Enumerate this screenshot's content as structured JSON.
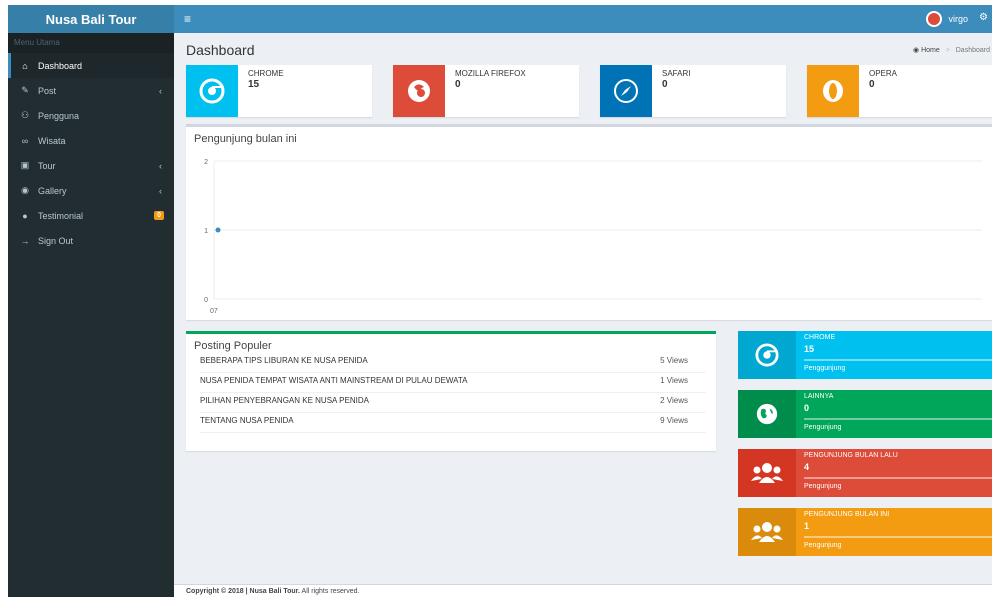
{
  "app": {
    "title": "Nusa Bali Tour"
  },
  "topbar": {
    "menu_icon": "hamburger-icon",
    "username": "virgo"
  },
  "sidebar": {
    "header": "Menu Utama",
    "items": [
      {
        "label": "Dashboard",
        "icon": "home-icon",
        "active": true
      },
      {
        "label": "Post",
        "icon": "pencil-icon",
        "chevron": "‹"
      },
      {
        "label": "Pengguna",
        "icon": "users-icon"
      },
      {
        "label": "Wisata",
        "icon": "hash-icon"
      },
      {
        "label": "Tour",
        "icon": "bus-icon",
        "chevron": "‹"
      },
      {
        "label": "Gallery",
        "icon": "camera-icon",
        "chevron": "‹"
      },
      {
        "label": "Testimonial",
        "icon": "comment-icon",
        "badge": "0"
      },
      {
        "label": "Sign Out",
        "icon": "sign-out-icon"
      }
    ]
  },
  "page": {
    "title": "Dashboard",
    "breadcrumb": {
      "home": "Home",
      "current": "Dashboard"
    }
  },
  "browsers": [
    {
      "name": "CHROME",
      "count": "15",
      "color": "#00c0ef",
      "icon": "chrome-icon"
    },
    {
      "name": "MOZILLA FIREFOX",
      "count": "0",
      "color": "#dd4b39",
      "icon": "firefox-icon"
    },
    {
      "name": "SAFARI",
      "count": "0",
      "color": "#0073b7",
      "icon": "safari-icon"
    },
    {
      "name": "OPERA",
      "count": "0",
      "color": "#f39c12",
      "icon": "opera-icon"
    }
  ],
  "visitors_chart": {
    "title": "Pengunjung bulan ini",
    "chart_data": {
      "type": "line",
      "title": "Pengunjung bulan ini",
      "x": [
        "07"
      ],
      "values": [
        1
      ],
      "ylim": [
        0,
        2
      ],
      "yticks": [
        "0",
        "1",
        "2"
      ],
      "grid": true,
      "color": "#3c8dbc"
    }
  },
  "popular": {
    "title": "Posting Populer",
    "rows": [
      {
        "title": "BEBERAPA TIPS LIBURAN KE NUSA PENIDA",
        "views": "5 Views"
      },
      {
        "title": "NUSA PENIDA TEMPAT WISATA ANTI MAINSTREAM DI PULAU DEWATA",
        "views": "1 Views"
      },
      {
        "title": "PILIHAN PENYEBRANGAN KE NUSA PENIDA",
        "views": "2 Views"
      },
      {
        "title": "TENTANG NUSA PENIDA",
        "views": "9 Views"
      }
    ]
  },
  "stats": [
    {
      "title": "CHROME",
      "count": "15",
      "desc": "Penggunjung",
      "color": "#00c0ef",
      "icon_bg": "#00a7d0",
      "icon": "chrome-icon"
    },
    {
      "title": "LAINNYA",
      "count": "0",
      "desc": "Pengunjung",
      "color": "#00a65a",
      "icon_bg": "#008d4c",
      "icon": "globe-icon"
    },
    {
      "title": "PENGUNJUNG BULAN LALU",
      "count": "4",
      "desc": "Pengunjung",
      "color": "#dd4b39",
      "icon_bg": "#d33724",
      "icon": "users-icon"
    },
    {
      "title": "PENGUNJUNG BULAN INI",
      "count": "1",
      "desc": "Pengunjung",
      "color": "#f39c12",
      "icon_bg": "#db8b0b",
      "icon": "users-icon"
    }
  ],
  "footer": {
    "prefix": "Copyright © 2018 | ",
    "brand": "Nusa Bali Tour.",
    "suffix": " All rights reserved."
  }
}
